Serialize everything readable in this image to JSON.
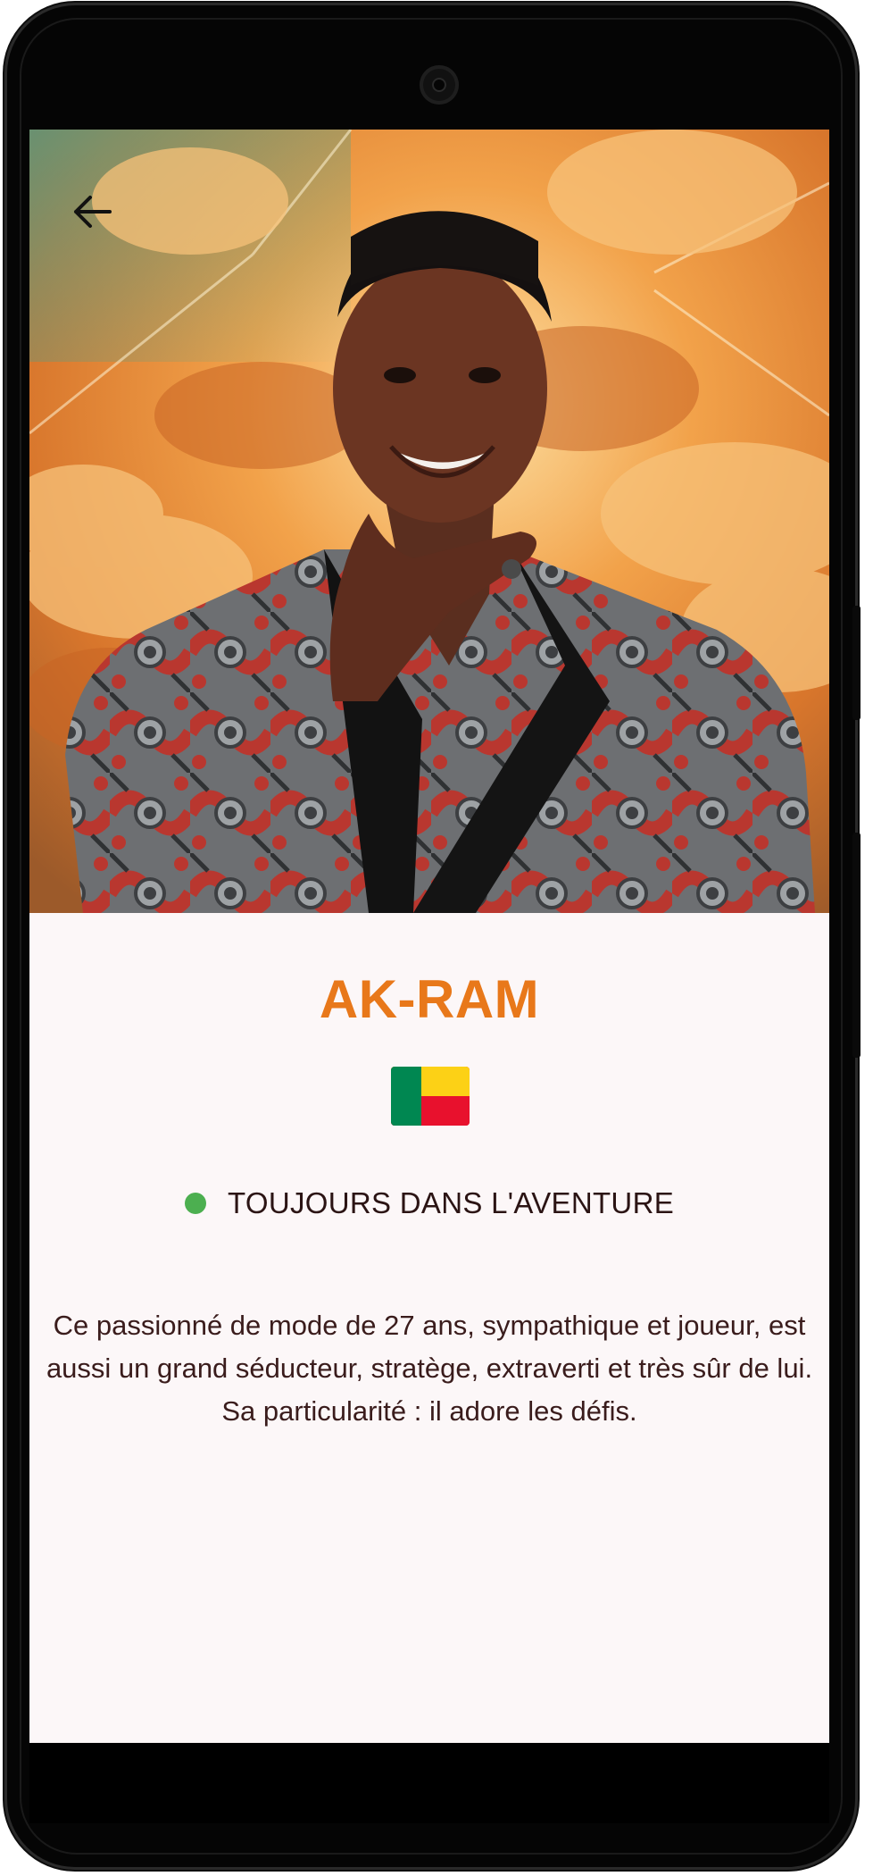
{
  "screen": {
    "back_icon": "arrow-left-icon"
  },
  "hero": {
    "image_desc": "portrait"
  },
  "profile": {
    "name": "AK-RAM",
    "flag_icon": "benin-flag-icon",
    "status_text": "TOUJOURS DANS L'AVENTURE",
    "status_color": "#4caf50",
    "bio": "Ce passionné de mode de 27 ans, sympathique et joueur, est aussi un grand séducteur, stratège, extraverti et très sûr de lui. Sa particularité : il adore les défis."
  },
  "colors": {
    "name_accent": "#e8781a",
    "background": "#fcf7f8",
    "text": "#3a1c1c"
  }
}
